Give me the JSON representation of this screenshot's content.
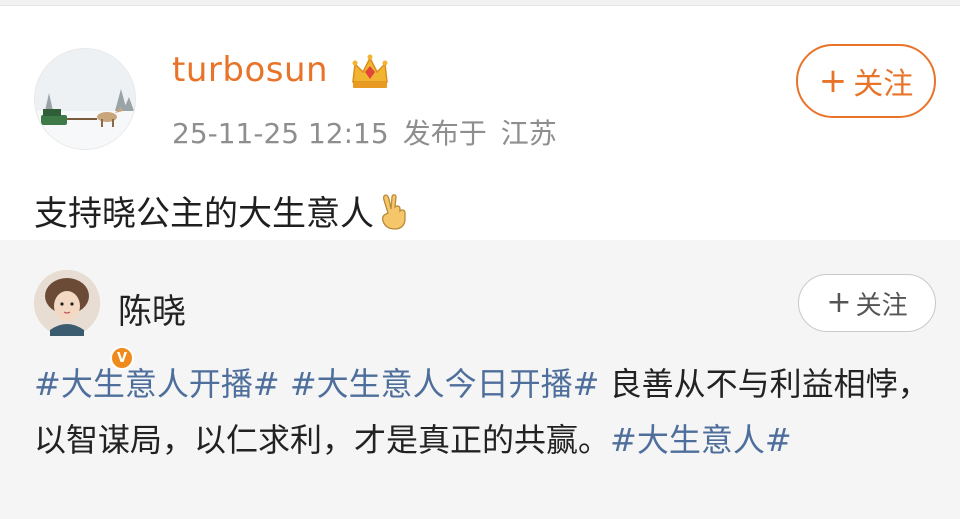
{
  "post": {
    "username": "turbosun",
    "badge_icon": "crown-icon",
    "timestamp": "25-11-25 12:15",
    "published_label": "发布于",
    "location": "江苏",
    "follow_label": "关注",
    "text": "支持晓公主的大生意人",
    "emoji": "victory-hand-icon"
  },
  "repost": {
    "author": "陈晓",
    "verified_badge": "V",
    "follow_label": "关注",
    "hashtag_1": "#大生意人开播#",
    "hashtag_2": "#大生意人今日开播#",
    "body": " 良善从不与利益相悖，以智谋局，以仁求利，才是真正的共赢。",
    "hashtag_3": "#大生意人#"
  },
  "colors": {
    "brand_orange": "#e8742a",
    "hashtag_blue": "#4e6f9c",
    "meta_gray": "#8e8e8e",
    "card_bg": "#f5f5f5"
  }
}
